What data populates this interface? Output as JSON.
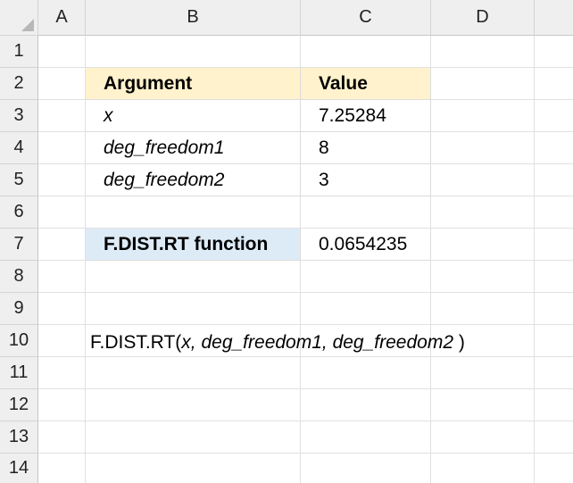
{
  "columns": [
    "A",
    "B",
    "C",
    "D"
  ],
  "rows": [
    "1",
    "2",
    "3",
    "4",
    "5",
    "6",
    "7",
    "8",
    "9",
    "10",
    "11",
    "12",
    "13",
    "14"
  ],
  "table": {
    "header_argument": "Argument",
    "header_value": "Value",
    "rows": [
      {
        "argument": "x",
        "value": "7.25284"
      },
      {
        "argument": "deg_freedom1",
        "value": "8"
      },
      {
        "argument": "deg_freedom2",
        "value": "3"
      }
    ]
  },
  "result": {
    "label": "F.DIST.RT function",
    "value": "0.0654235"
  },
  "formula": {
    "name": "F.DIST.RT(",
    "args": "x, deg_freedom1, deg_freedom2",
    "close": " )"
  },
  "colors": {
    "argument_header_fill": "#fff2cc",
    "function_label_fill": "#ddebf7",
    "header_background": "#efefef"
  }
}
